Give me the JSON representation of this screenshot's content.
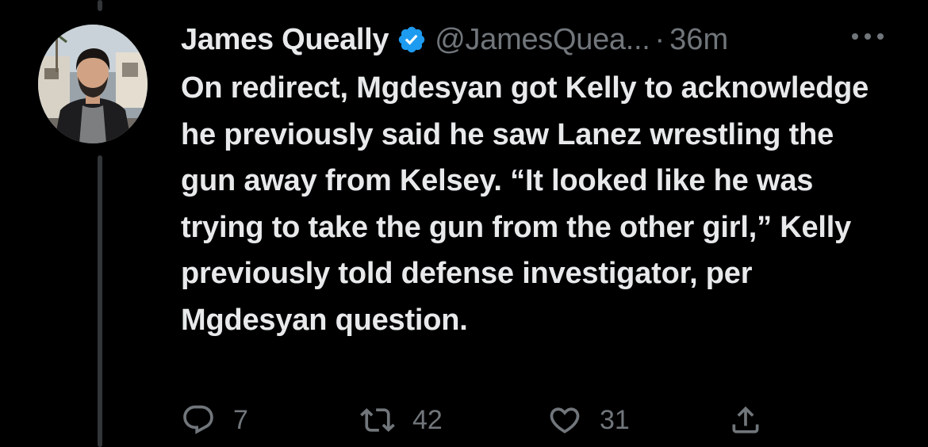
{
  "tweet": {
    "display_name": "James Queally",
    "handle": "@JamesQuea...",
    "separator": "·",
    "time": "36m",
    "body": "On redirect, Mgdesyan got Kelly to acknowledge he previously said he saw Lanez wrestling the gun away from Kelsey. “It looked like he was trying to take the gun from the other girl,” Kelly previously told defense investigator, per Mgdesyan question.",
    "verified": true,
    "icons": {
      "verified": "verified-badge-icon",
      "more": "more-options-icon",
      "reply": "reply-icon",
      "retweet": "retweet-icon",
      "like": "like-icon",
      "share": "share-icon"
    }
  },
  "actions": {
    "replies": "7",
    "retweets": "42",
    "likes": "31"
  },
  "colors": {
    "background": "#000000",
    "text_primary": "#e7e9ea",
    "text_secondary": "#71767b",
    "verified_blue": "#1d9bf0",
    "thread_line": "#333639"
  }
}
